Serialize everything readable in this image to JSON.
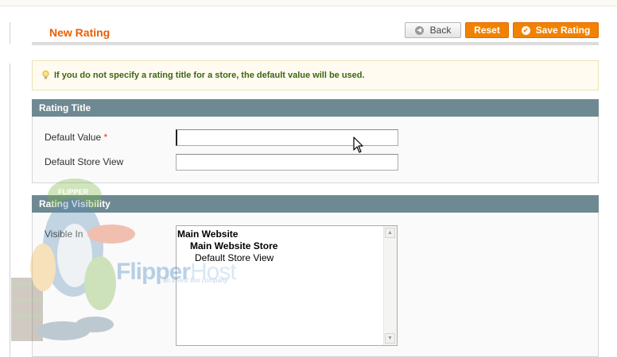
{
  "header": {
    "title": "New Rating",
    "buttons": {
      "back": "Back",
      "reset": "Reset",
      "save": "Save Rating"
    }
  },
  "notice": {
    "text": "If you do not specify a rating title for a store, the default value will be used."
  },
  "rating_title": {
    "heading": "Rating Title",
    "fields": {
      "default_value": {
        "label": "Default Value",
        "required_mark": "*",
        "value": ""
      },
      "default_store_view": {
        "label": "Default Store View",
        "value": ""
      }
    }
  },
  "rating_visibility": {
    "heading": "Rating Visibility",
    "visible_in": {
      "label": "Visible In",
      "website": "Main Website",
      "store": "Main Website Store",
      "store_view": "Default Store View"
    }
  },
  "watermark": {
    "logo_part1": "Flipper",
    "logo_part2": "Host",
    "tagline": "an invest lion company",
    "mascot_badge": "FLIPPER"
  },
  "colors": {
    "accent": "#eb5e00",
    "button_orange": "#f18200",
    "section_header": "#6f8992",
    "notice_text": "#3d6611"
  }
}
